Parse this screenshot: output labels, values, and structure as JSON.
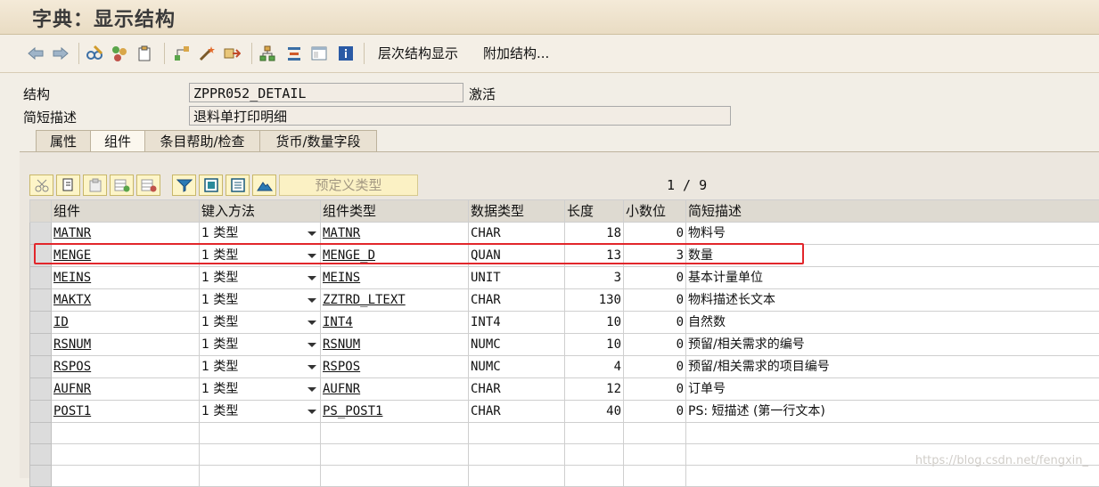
{
  "window": {
    "title": "字典：显示结构"
  },
  "toolbar": {
    "hierarchy_label": "层次结构显示",
    "append_label": "附加结构..."
  },
  "header": {
    "structure_label": "结构",
    "structure_value": "ZPPR052_DETAIL",
    "status": "激活",
    "desc_label": "简短描述",
    "desc_value": "退料单打印明细"
  },
  "tabs": [
    {
      "label": "属性"
    },
    {
      "label": "组件",
      "active": true
    },
    {
      "label": "条目帮助/检查"
    },
    {
      "label": "货币/数量字段"
    }
  ],
  "grid_toolbar": {
    "predefined_type_label": "预定义类型",
    "pager": "1 / 9"
  },
  "table": {
    "columns": [
      "组件",
      "键入方法",
      "组件类型",
      "数据类型",
      "长度",
      "小数位",
      "简短描述"
    ],
    "rows": [
      {
        "component": "MATNR",
        "method": "1 类型",
        "type": "MATNR",
        "datatype": "CHAR",
        "length": "18",
        "decimals": "0",
        "desc": "物料号"
      },
      {
        "component": "MENGE",
        "method": "1 类型",
        "type": "MENGE_D",
        "datatype": "QUAN",
        "length": "13",
        "decimals": "3",
        "desc": "数量"
      },
      {
        "component": "MEINS",
        "method": "1 类型",
        "type": "MEINS",
        "datatype": "UNIT",
        "length": "3",
        "decimals": "0",
        "desc": "基本计量单位"
      },
      {
        "component": "MAKTX",
        "method": "1 类型",
        "type": "ZZTRD_LTEXT",
        "datatype": "CHAR",
        "length": "130",
        "decimals": "0",
        "desc": "物料描述长文本"
      },
      {
        "component": "ID",
        "method": "1 类型",
        "type": "INT4",
        "datatype": "INT4",
        "length": "10",
        "decimals": "0",
        "desc": "自然数"
      },
      {
        "component": "RSNUM",
        "method": "1 类型",
        "type": "RSNUM",
        "datatype": "NUMC",
        "length": "10",
        "decimals": "0",
        "desc": "预留/相关需求的编号"
      },
      {
        "component": "RSPOS",
        "method": "1 类型",
        "type": "RSPOS",
        "datatype": "NUMC",
        "length": "4",
        "decimals": "0",
        "desc": "预留/相关需求的项目编号"
      },
      {
        "component": "AUFNR",
        "method": "1 类型",
        "type": "AUFNR",
        "datatype": "CHAR",
        "length": "12",
        "decimals": "0",
        "desc": "订单号"
      },
      {
        "component": "POST1",
        "method": "1 类型",
        "type": "PS_POST1",
        "datatype": "CHAR",
        "length": "40",
        "decimals": "0",
        "desc": "PS: 短描述 (第一行文本)"
      }
    ]
  },
  "watermark": "https://blog.csdn.net/fengxin_",
  "colors": {
    "highlight": "#e2262b",
    "button_bg": "#fdf5c8"
  }
}
